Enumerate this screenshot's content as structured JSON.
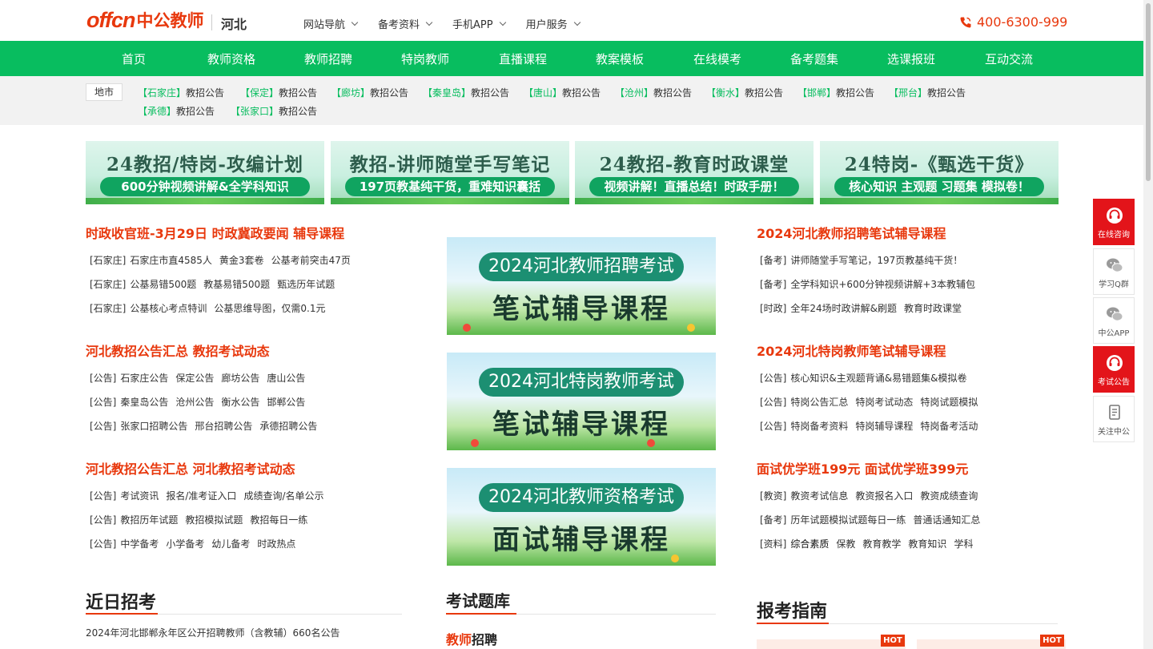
{
  "brand": {
    "logo_latin": "offcn",
    "logo_cn": "中公教师",
    "region": "河北"
  },
  "topnav": [
    "网站导航",
    "备考资料",
    "手机APP",
    "用户服务"
  ],
  "hotline": "400-6300-999",
  "mainnav": [
    "首页",
    "教师资格",
    "教师招聘",
    "特岗教师",
    "直播课程",
    "教案模板",
    "在线模考",
    "备考题集",
    "选课报班",
    "互动交流"
  ],
  "cities": {
    "label": "地市",
    "suffix": "教招公告",
    "items": [
      "【石家庄】",
      "【保定】",
      "【廊坊】",
      "【秦皇岛】",
      "【唐山】",
      "【沧州】",
      "【衡水】",
      "【邯郸】",
      "【邢台】",
      "【承德】",
      "【张家口】"
    ]
  },
  "banners": [
    {
      "title": "24教招/特岗-攻编计划",
      "sub": "600分钟视频讲解&全学科知识"
    },
    {
      "title": "教招-讲师随堂手写笔记",
      "sub": "197页教基纯干货，重难知识囊括"
    },
    {
      "title": "24教招-教育时政课堂",
      "sub": "视频讲解！直播总结！时政手册！"
    },
    {
      "title": "24特岗-《甄选干货》",
      "sub": "核心知识 主观题 习题集 模拟卷！"
    }
  ],
  "left": [
    {
      "title": "时政收官班-3月29日 时政冀政要闻 辅导课程",
      "rows": [
        {
          "tag": "[石家庄]",
          "links": [
            "石家庄市直4585人",
            "黄金3套卷",
            "公基考前突击47页"
          ]
        },
        {
          "tag": "[石家庄]",
          "links": [
            "公基易错500题",
            "教基易错500题",
            "甄选历年试题"
          ]
        },
        {
          "tag": "[石家庄]",
          "links": [
            "公基核心考点特训",
            "公基思维导图，仅需0.1元"
          ]
        }
      ]
    },
    {
      "title": "河北教招公告汇总 教招考试动态",
      "rows": [
        {
          "tag": "[公告]",
          "links": [
            "石家庄公告",
            "保定公告",
            "廊坊公告",
            "唐山公告"
          ]
        },
        {
          "tag": "[公告]",
          "links": [
            "秦皇岛公告",
            "沧州公告",
            "衡水公告",
            "邯郸公告"
          ]
        },
        {
          "tag": "[公告]",
          "links": [
            "张家口招聘公告",
            "邢台招聘公告",
            "承德招聘公告"
          ]
        }
      ]
    },
    {
      "title": "河北教招公告汇总 河北教招考试动态",
      "rows": [
        {
          "tag": "[公告]",
          "links": [
            "考试资讯",
            "报名/准考证入口",
            "成绩查询/名单公示"
          ]
        },
        {
          "tag": "[公告]",
          "links": [
            "教招历年试题",
            "教招模拟试题",
            "教招每日一练"
          ]
        },
        {
          "tag": "[公告]",
          "links": [
            "中学备考",
            "小学备考",
            "幼儿备考",
            "时政热点"
          ]
        }
      ]
    }
  ],
  "promos": [
    {
      "pill": "2024河北教师招聘考试",
      "big": "笔试辅导课程"
    },
    {
      "pill": "2024河北特岗教师考试",
      "big": "笔试辅导课程"
    },
    {
      "pill": "2024河北教师资格考试",
      "big": "面试辅导课程"
    }
  ],
  "right": [
    {
      "title": "2024河北教师招聘笔试辅导课程",
      "rows": [
        {
          "tag": "[备考]",
          "links": [
            "讲师随堂手写笔记，197页教基纯干货！"
          ]
        },
        {
          "tag": "[备考]",
          "links": [
            "全学科知识+600分钟视频讲解+3本教辅包"
          ]
        },
        {
          "tag": "[时政]",
          "links": [
            "全年24场时政讲解&刷题",
            "教育时政课堂"
          ]
        }
      ]
    },
    {
      "title": "2024河北特岗教师笔试辅导课程",
      "rows": [
        {
          "tag": "[公告]",
          "links": [
            "核心知识&主观题背诵&易错题集&模拟卷"
          ]
        },
        {
          "tag": "[公告]",
          "links": [
            "特岗公告汇总",
            "特岗考试动态",
            "特岗试题模拟"
          ]
        },
        {
          "tag": "[公告]",
          "links": [
            "特岗备考资料",
            "特岗辅导课程",
            "特岗备考活动"
          ]
        }
      ]
    },
    {
      "title": "面试优学班199元 面试优学班399元",
      "rows": [
        {
          "tag": "[教资]",
          "links": [
            "教资考试信息",
            "教资报名入口",
            "教资成绩查询"
          ]
        },
        {
          "tag": "[备考]",
          "links": [
            "历年试题模拟试题每日一练",
            "普通话通知汇总"
          ]
        },
        {
          "tag": "[资料]",
          "links": [
            "综合素质",
            "保教",
            "教育教学",
            "教育知识",
            "学科"
          ]
        }
      ]
    }
  ],
  "bottom": {
    "recent_title": "近日招考",
    "recent_item": "2024年河北邯郸永年区公开招聘教师（含教辅）660名公告",
    "bank_title": "考试题库",
    "bank_tab_red": "教师",
    "bank_tab_black": "招聘",
    "guide_title": "报考指南",
    "hot": "HOT"
  },
  "float_tools": [
    "在线咨询",
    "学习Q群",
    "中公APP",
    "考试公告",
    "关注中公"
  ],
  "colors": {
    "brand_red": "#e8380d",
    "nav_green": "#08bd5f",
    "tool_red": "#e3141a"
  }
}
